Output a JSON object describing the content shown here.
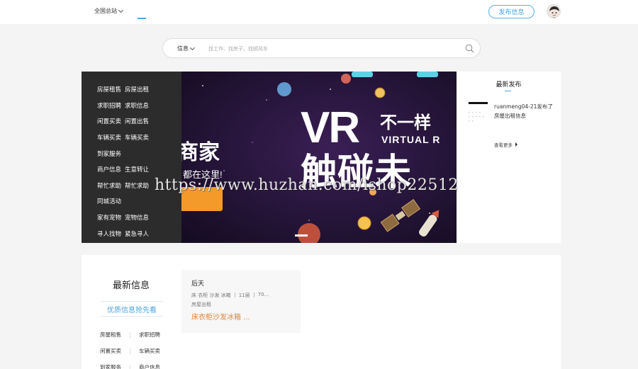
{
  "header": {
    "city_label": "全国总站",
    "publish_label": "发布信息"
  },
  "search": {
    "category": "信息",
    "placeholder": "找工作、找房子、找顺风车"
  },
  "categories": [
    [
      "房屋租售",
      "房屋出租"
    ],
    [
      "求职招聘",
      "求职信息"
    ],
    [
      "闲置买卖",
      "闲置出售"
    ],
    [
      "车辆买卖",
      "车辆买卖"
    ],
    [
      "到家服务"
    ],
    [
      "商户信息",
      "生意转让"
    ],
    [
      "帮忙求助",
      "帮忙求助"
    ],
    [
      "同城活动"
    ],
    [
      "家有宠物",
      "宠物信息"
    ],
    [
      "寻人找物",
      "紧急寻人"
    ]
  ],
  "banner": {
    "headline": "VR不一样",
    "subline": "VIRTUAL R",
    "headline2": "触碰未",
    "left_text": "商家",
    "left_sub": "都在这里!"
  },
  "latest_publish": {
    "title": "最新发布",
    "item_text": "ruanmeng04-21发布了房屋出租信息",
    "more_label": "查看更多"
  },
  "watermark": "https://www.huzhan.com/ishop22512",
  "latest_info": {
    "title": "最新信息",
    "premium_label": "优质信息抢先看",
    "categories": [
      [
        "房屋租售",
        "求职招聘"
      ],
      [
        "闲置买卖",
        "车辆买卖"
      ],
      [
        "到家服务",
        "商户信息"
      ]
    ]
  },
  "card": {
    "title": "后天",
    "meta_items": [
      "床 衣柜 沙发 冰箱",
      "11层",
      "70..."
    ],
    "category": "房屋出租",
    "price": "床衣柜沙发冰箱 ..."
  },
  "colors": {
    "accent": "#4aa3df",
    "price": "#e0843a",
    "menu_bg": "#2c2c2c"
  }
}
